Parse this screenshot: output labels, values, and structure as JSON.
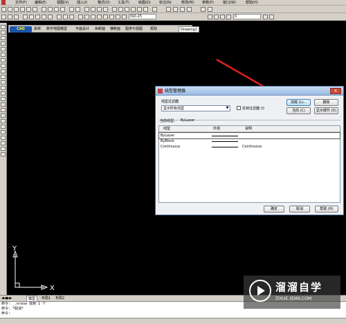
{
  "menubar": {
    "items": [
      "文件(F)",
      "编辑(E)",
      "视图(V)",
      "插入(I)",
      "格式(O)",
      "工具(T)",
      "绘图(D)",
      "标注(N)",
      "修改(M)",
      "参数(P)",
      "窗口(W)",
      "帮助(H)"
    ]
  },
  "toolbar": {
    "layer_combo": "0",
    "dimstyle_combo": "ISO-25"
  },
  "inner_menu": {
    "brand": "CAD",
    "items": [
      "系统",
      "数字地图模型",
      "平面设计",
      "纵断面",
      "横断面",
      "图表与视图",
      "帮助"
    ],
    "drawing_tab": "Drawing1"
  },
  "dialog": {
    "title": "线型管理器",
    "close_label": "✕",
    "filter_label": "线型过滤器",
    "filter_value": "显示所有线型",
    "invert_label": "反转过滤器 (I)",
    "current_label": "当前线型:",
    "current_value": "ByLayer",
    "buttons": {
      "load": "加载 (L)...",
      "delete": "删除",
      "current": "当前 (C)",
      "details": "显示细节 (D)",
      "ok": "确定",
      "cancel": "取消",
      "help": "帮助 (H)"
    },
    "columns": [
      "线型",
      "外观",
      "说明"
    ],
    "rows": [
      {
        "name": "ByLayer",
        "desc": ""
      },
      {
        "name": "ByBlock",
        "desc": ""
      },
      {
        "name": "Continuous",
        "desc": "Continuous"
      }
    ]
  },
  "axes": {
    "x": "X",
    "y": "Y"
  },
  "layout_tabs": {
    "model": "模型",
    "layout1": "布局1",
    "layout2": "布局2"
  },
  "command": {
    "line1": "命令: _.erase 找到 1 个",
    "line2": "命令: *取消*",
    "line3": "命令:"
  },
  "watermark": {
    "title": "溜溜自学",
    "url": "ZIXUE.3D66.COM"
  },
  "colors": {
    "arrow": "#e0201c",
    "canvas": "#000000",
    "dialog_bg": "#eef0f4",
    "chrome": "#d4d0c8"
  }
}
